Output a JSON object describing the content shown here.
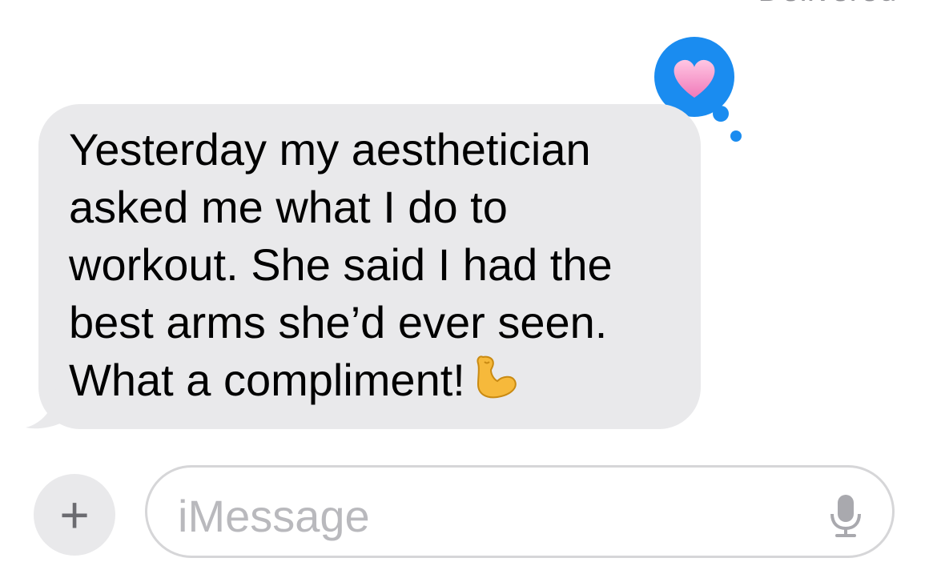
{
  "header": {
    "status": "Delivered"
  },
  "message": {
    "lines": [
      "Yesterday my aesthetician",
      "asked me what I do to",
      "workout. She said I had the",
      "best arms she’d ever seen.",
      "What a compliment!"
    ],
    "emoji": "flexed-biceps"
  },
  "tapback": {
    "reaction": "heart",
    "bubble_color": "#1a8cf0",
    "heart_color": "#f8a9d0"
  },
  "composer": {
    "plus_label": "+",
    "placeholder": "iMessage",
    "mic_icon": "microphone-icon"
  },
  "colors": {
    "received_bubble": "#e9e9eb",
    "placeholder_text": "#b9b9bd"
  }
}
